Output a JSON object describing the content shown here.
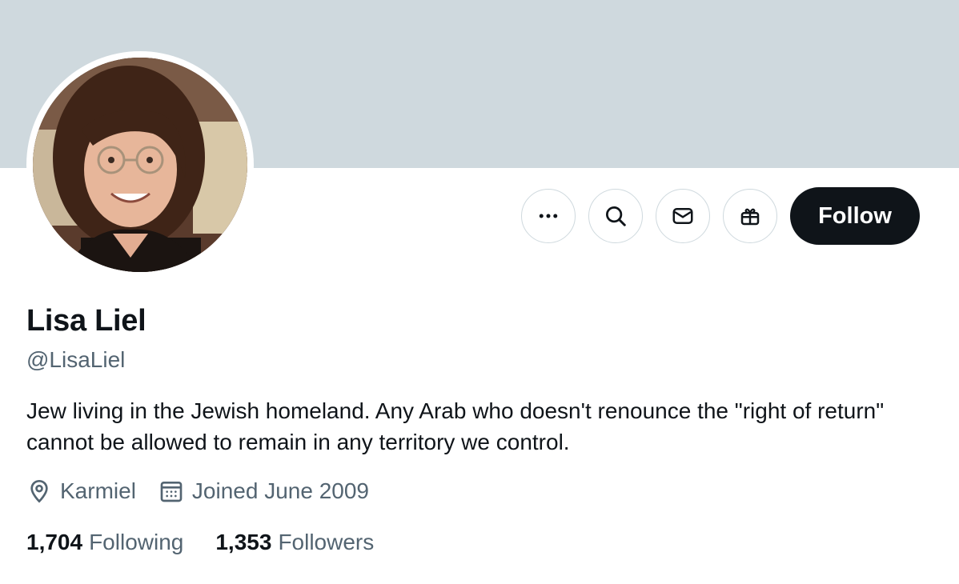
{
  "profile": {
    "name": "Lisa Liel",
    "handle": "@LisaLiel",
    "bio": "Jew living in the Jewish homeland. Any Arab who doesn't renounce the \"right of return\" cannot be allowed to remain in any territory we control.",
    "location": "Karmiel",
    "joined": "Joined June 2009"
  },
  "stats": {
    "following_count": "1,704",
    "following_label": "Following",
    "followers_count": "1,353",
    "followers_label": "Followers"
  },
  "actions": {
    "follow_label": "Follow",
    "icons": [
      "more-icon",
      "search-icon",
      "message-icon",
      "gift-icon"
    ]
  },
  "colors": {
    "banner": "#cfd9de",
    "text_primary": "#0f1419",
    "text_secondary": "#536471",
    "follow_bg": "#0f1419"
  }
}
